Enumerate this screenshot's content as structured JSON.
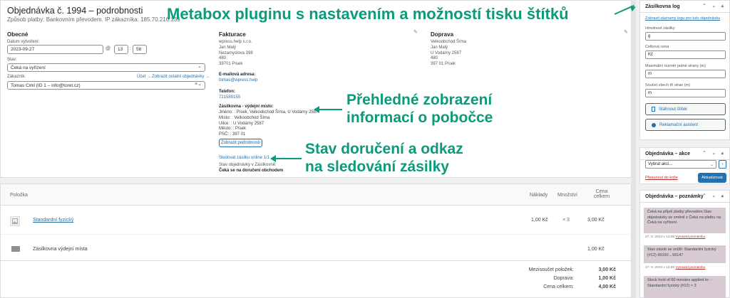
{
  "order": {
    "title": "Objednávka č. 1994 – podrobnosti",
    "meta": "Způsob platby: Bankovním převodem. IP zákazníka: 185.70.216.139",
    "general": {
      "heading": "Obecné",
      "date_label": "Datum vytvoření:",
      "date_value": "2023-09-27",
      "at": "@",
      "hour": "13",
      "minute": "58",
      "status_label": "Stav:",
      "status_value": "Čeká na vyřízení",
      "customer_label": "Zákazník:",
      "customer_profile_link": "Účet →",
      "customer_orders_link": "Zobrazit ostatní objednávky →",
      "customer_value": "Tomas Cirkl (ID 1 – info@toret.cz)",
      "clear": "×"
    },
    "billing": {
      "heading": "Fakturace",
      "address": [
        "wpress.help s.r.o.",
        "Jan Malý",
        "Nezamyslova 398",
        "480",
        "39701 Písek"
      ],
      "email_label": "E-mailová adresa:",
      "email": "tomas@wpress.help",
      "phone_label": "Telefon:",
      "phone": "721589155",
      "pickup_heading": "Zásilkovna - výdejní místo:",
      "pickup_lines": [
        "Jméno: : Písek, Velkoobchod Šíma, U Vodárny 2587",
        "Místo: : Velkoobchod Šíma",
        "Ulice: : U Vodárny 2587",
        "Město: : Písek",
        "PSČ: : 397 01"
      ],
      "show_details_button": "Zobrazit podrobnosti",
      "tracking_link": "Sledovat zásilku online 1/1",
      "order_state_label": "Stav objednávky v Zásilkovně:",
      "order_state_value": "Čeká se na doručení obchodem"
    },
    "shipping": {
      "heading": "Doprava",
      "address": [
        "Velkoobchod Šíma",
        "Jan Malý",
        "U Vodárny 2587",
        "480",
        "397 01 Písek"
      ]
    },
    "edit_icon": "✎"
  },
  "items": {
    "headers": {
      "item": "Položka",
      "cost": "Náklady",
      "qty": "Množství",
      "total_line1": "Cena",
      "total_line2": "celkem"
    },
    "rows": [
      {
        "name": "Standardní fyzický",
        "cost": "1,00 Kč",
        "qty": "× 3",
        "total": "3,00 Kč"
      }
    ],
    "shipping_row": {
      "name": "Zásilkovna výdejní místa",
      "total": "1,00 Kč"
    },
    "totals": [
      {
        "label": "Mezisoučet položek:",
        "value": "3,00 Kč"
      },
      {
        "label": "Doprava:",
        "value": "1,00 Kč"
      },
      {
        "label": "Cena celkem:",
        "value": "4,00 Kč"
      }
    ]
  },
  "sidebar": {
    "zasilkovna": {
      "title": "Zásilkovna log",
      "link": "Zobrazit záznamy logu pro tuto objednávku",
      "weight_label": "Hmotnost zásilky",
      "weight_value": "g",
      "price_label": "Celková cena",
      "price_value": "Kč",
      "maxdim_label": "Maximální rozměr jedné strany (m)",
      "maxdim_value": "m",
      "sum_label": "Součet všech tří stran (m)",
      "sum_value": "m",
      "download_button": "Stáhnout štítek",
      "claim_button": "Reklamační asistent"
    },
    "actions": {
      "title": "Objednávka – akce",
      "select": "Vybrat akci...",
      "trash": "Přesunout do koše",
      "update": "Aktualizovat"
    },
    "notes": {
      "title": "Objednávka – poznámky",
      "items": [
        {
          "text": "Čeká na přijetí platby převodem Stav objednávky se změnil z Čeká na platbu na Čeká na vyřízení.",
          "date": "27. 9. 2023 v 13:58",
          "delete": "Vymazat poznámku"
        },
        {
          "text": "Stav zásob se snížil: Standardní fyzický (#12) 99150→99147",
          "date": "27. 9. 2023 v 13:58",
          "delete": "Vymazat poznámku"
        },
        {
          "text": "Stock hold of 60 minutes applied to: - Standardní fyzický (#12) × 3",
          "date": "",
          "delete": ""
        }
      ]
    },
    "box_controls": "⌃ ⌄ ▴"
  },
  "annotations": {
    "top": "Metabox pluginu s nastavením  a možností tisku štítků",
    "middle_line1": "Přehledné zobrazení",
    "middle_line2": "informací o pobočce",
    "bottom_line1": "Stav doručení a odkaz",
    "bottom_line2": "na sledování zásilky"
  },
  "colors": {
    "accent": "#0b9a7a",
    "link": "#2271b1",
    "note": "#d7cad2"
  }
}
